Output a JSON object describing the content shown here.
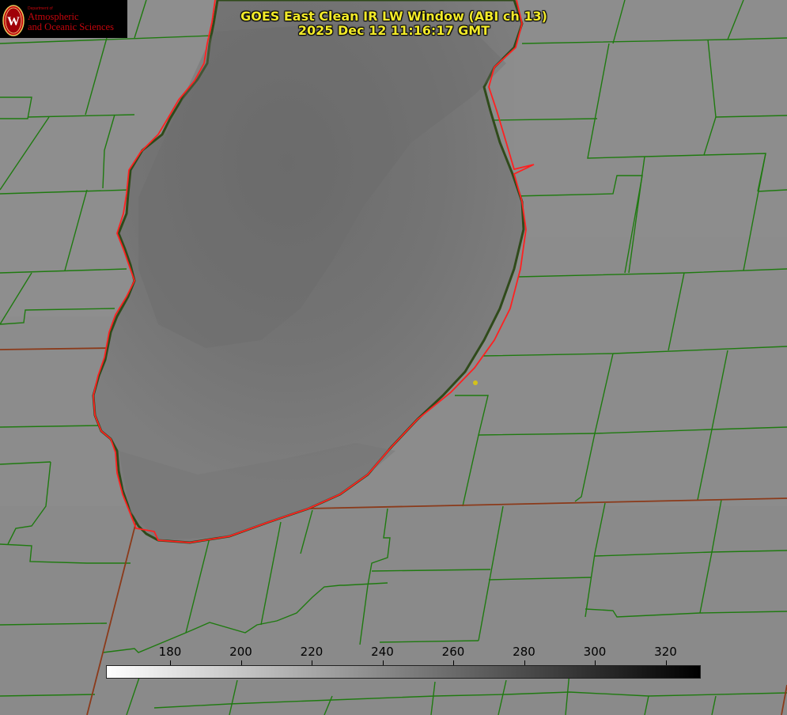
{
  "title": {
    "line1": "GOES East Clean IR LW Window (ABI ch 13)",
    "line2": "2025 Dec 12 11:16:17 GMT"
  },
  "logo": {
    "seal_letter": "W",
    "department": "Department of",
    "line1": "Atmospheric",
    "line2": "and Oceanic Sciences"
  },
  "colorbar": {
    "ticks": [
      "180",
      "200",
      "220",
      "240",
      "260",
      "280",
      "300",
      "320"
    ],
    "gradient": [
      "#ffffff",
      "#000000"
    ]
  },
  "colors": {
    "title_yellow": "#f2ea2a",
    "lake_outline": "#ff2020",
    "county_lines": "#1f7a10",
    "state_lines": "#8b3a1a",
    "marker": "#d4c21a",
    "logo_red": "#c5050c"
  }
}
